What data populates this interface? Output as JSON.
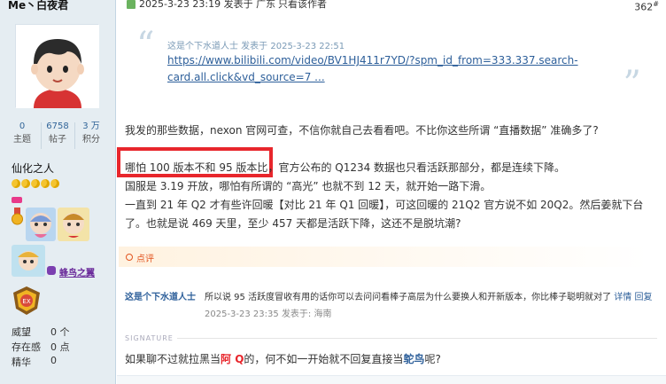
{
  "profile": {
    "username": "Me丶白夜君",
    "stats": [
      {
        "value": "0",
        "label": "主题"
      },
      {
        "value": "6758",
        "label": "帖子"
      },
      {
        "value": "3 万",
        "label": "积分"
      }
    ],
    "rank_title": "仙化之人",
    "medal_name": "蜂鸟之翼",
    "attributes": [
      {
        "label": "威望",
        "value": "0 个"
      },
      {
        "label": "存在感",
        "value": "0 点"
      },
      {
        "label": "精华",
        "value": "0"
      }
    ]
  },
  "post": {
    "date_line": "2025-3-23 23:19 发表于 广东",
    "only_author": "只看该作者",
    "floor": "362",
    "floor_sup": "#",
    "quote": {
      "author_line": "这是个下水道人士 发表于 2025-3-23 22:51",
      "link_text": "https://www.bilibili.com/video/BV1HJ411r7YD/?spm_id_from=333.337.search-card.all.click&vd_source=7 ..."
    },
    "paragraph1": "我发的那些数据，nexon 官网可查，不信你就自己去看看吧。不比你这些所谓 “直播数据” 准确多了?",
    "line_highlighted": "哪怕 100 版本不和 95 版本比",
    "line_rest": "，官方公布的 Q1234 数据也只看活跃那部分，都是连续下降。",
    "line2": "国服是 3.19 开放，哪怕有所谓的 “高光” 也就不到 12 天，就开始一路下滑。",
    "line3": "一直到 21 年 Q2 才有些许回暖【对比 21 年 Q1 回暖】，可这回暖的 21Q2 官方说不如 20Q2。然后姜就下台",
    "line4": "了。也就是说 469 天里，至少 457 天都是活跃下降，这还不是脱坑潮?",
    "rate_label": "点评"
  },
  "reply": {
    "author": "这是个下水道人士",
    "text": "所以说 95 活跃度冒收有用的话你可以去问问看棒子高层为什么要换人和开新版本，你比棒子聪明就对了",
    "detail_link": "详情",
    "reply_link": "回复",
    "time": "2025-3-23 23:35",
    "location": "发表于: 海南"
  },
  "signature": {
    "label": "SIGNATURE",
    "pre": "如果聊不过就拉黑当",
    "red_word": "阿 Q",
    "mid": "的，何不如一开始就不回复直接当",
    "blue_word": "鸵鸟",
    "post": "呢?"
  },
  "colors": {
    "sidebar_bg": "#E5EDF2",
    "link_blue": "#2d5f9a",
    "highlight_red": "#e8262c",
    "rate_orange": "#e2541f"
  }
}
